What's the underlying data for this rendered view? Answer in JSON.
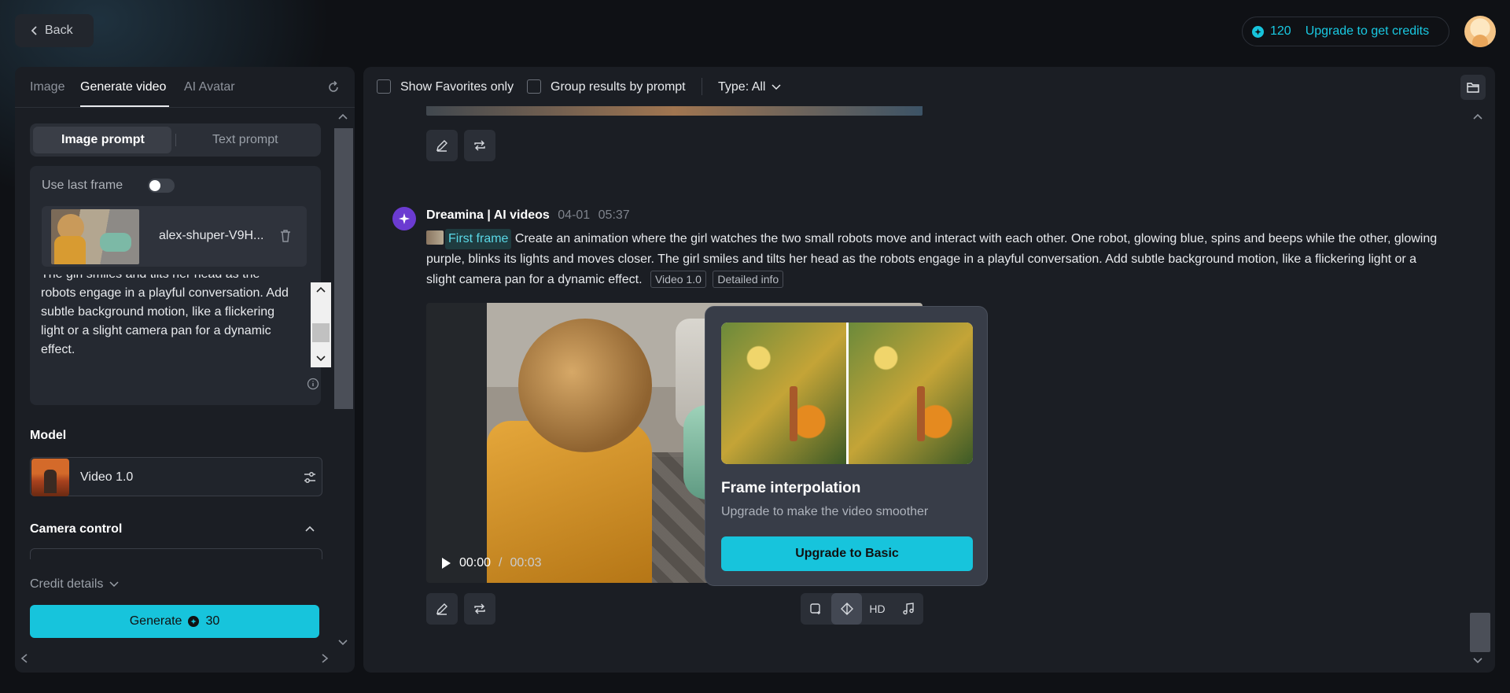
{
  "header": {
    "back_label": "Back",
    "credits": "120",
    "upgrade_label": "Upgrade to get credits"
  },
  "left": {
    "tabs": [
      {
        "label": "Image"
      },
      {
        "label": "Generate video"
      },
      {
        "label": "AI Avatar"
      }
    ],
    "prompt_modes": {
      "image": "Image prompt",
      "text": "Text prompt"
    },
    "use_last_frame_label": "Use last frame",
    "file_name": "alex-shuper-V9H...",
    "prompt_text": "The girl smiles and tilts her head as the robots engage in a playful conversation. Add subtle background motion, like a flickering light or a slight camera pan for a dynamic effect.",
    "model_label": "Model",
    "model_name": "Video 1.0",
    "camera_label": "Camera control",
    "credit_details_label": "Credit details",
    "generate_label": "Generate",
    "generate_cost": "30"
  },
  "right": {
    "filters": {
      "favorites": "Show Favorites only",
      "group": "Group results by prompt",
      "type": "Type: All"
    },
    "entry": {
      "author": "Dreamina | AI videos",
      "date": "04-01",
      "time": "05:37",
      "first_frame_label": "First frame",
      "prompt": "Create an animation where the girl watches the two small robots move and interact with each other. One robot, glowing blue, spins and beeps while the other, glowing purple, blinks its lights and moves closer. The girl smiles and tilts her head as the robots engage in a playful conversation. Add subtle background motion, like a flickering light or a slight camera pan for a dynamic effect.",
      "model_chip": "Video 1.0",
      "details_chip": "Detailed info",
      "video_current": "00:00",
      "video_sep": "/",
      "video_duration": "00:03",
      "hd_label": "HD"
    },
    "popup": {
      "title": "Frame interpolation",
      "subtitle": "Upgrade to make the video smoother",
      "button": "Upgrade to Basic"
    }
  },
  "colors": {
    "accent": "#17c4dc",
    "panel": "#1b1e24",
    "background": "#0f1115"
  }
}
